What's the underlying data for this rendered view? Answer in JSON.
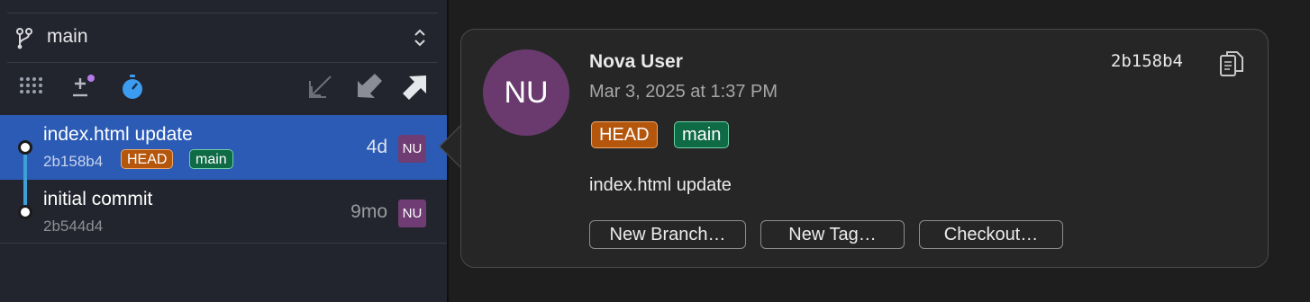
{
  "sidebar": {
    "branch": "main",
    "commits": [
      {
        "title": "index.html update",
        "hash": "2b158b4",
        "tags": [
          "HEAD",
          "main"
        ],
        "age": "4d",
        "avatar": "NU",
        "selected": true
      },
      {
        "title": "initial commit",
        "hash": "2b544d4",
        "tags": [],
        "age": "9mo",
        "avatar": "NU",
        "selected": false
      }
    ]
  },
  "popover": {
    "avatar_initials": "NU",
    "author": "Nova User",
    "date": "Mar 3, 2025 at 1:37 PM",
    "hash": "2b158b4",
    "tags": [
      "HEAD",
      "main"
    ],
    "message": "index.html update",
    "buttons": {
      "new_branch": "New Branch…",
      "new_tag": "New Tag…",
      "checkout": "Checkout…"
    }
  },
  "colors": {
    "selected_row": "#2b5bb5",
    "head_tag": "#b5560d",
    "main_tag": "#0f6a46",
    "avatar": "#6f3c73",
    "graph_line": "#3fa0d8",
    "accent_badge": "#b77be9"
  },
  "icons": {
    "branch": "git-branch-icon",
    "updown": "chevron-updown-icon",
    "graph": "graph-dots-icon",
    "add_remove": "plus-minus-icon",
    "stopwatch": "stopwatch-icon",
    "fetch": "fetch-arrow-icon",
    "pull": "pull-arrow-icon",
    "push": "push-arrow-icon",
    "copy": "copy-icon"
  }
}
